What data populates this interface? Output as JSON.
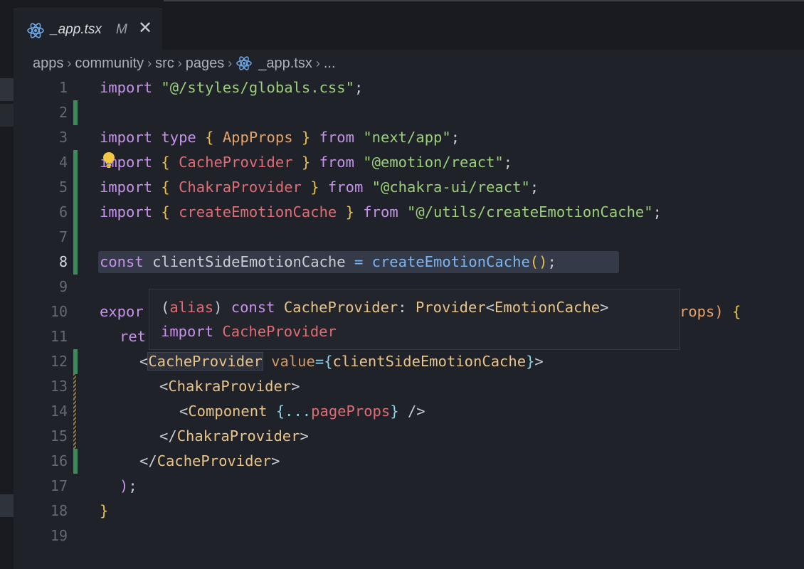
{
  "tab": {
    "filename": "_app.tsx",
    "status": "M"
  },
  "breadcrumb": [
    "apps",
    "community",
    "src",
    "pages",
    "_app.tsx",
    "..."
  ],
  "lines": [
    "1",
    "2",
    "3",
    "4",
    "5",
    "6",
    "7",
    "8",
    "9",
    "10",
    "11",
    "12",
    "13",
    "14",
    "15",
    "16",
    "17",
    "18",
    "19"
  ],
  "active_line": "8",
  "code": {
    "l1": {
      "kw": "import",
      "str": "\"@/styles/globals.css\"",
      "end": ";"
    },
    "l3": {
      "kw1": "import",
      "kw2": "type",
      "ob": "{",
      "id": "AppProps",
      "cb": "}",
      "from": "from",
      "str": "\"next/app\"",
      "end": ";"
    },
    "l4": {
      "kw": "import",
      "ob": "{",
      "id": "CacheProvider",
      "cb": "}",
      "from": "from",
      "str": "\"@emotion/react\"",
      "end": ";"
    },
    "l5": {
      "kw": "import",
      "ob": "{",
      "id": "ChakraProvider",
      "cb": "}",
      "from": "from",
      "str": "\"@chakra-ui/react\"",
      "end": ";"
    },
    "l6": {
      "kw": "import",
      "ob": "{",
      "id": "createEmotionCache",
      "cb": "}",
      "from": "from",
      "str": "\"@/utils/createEmotionCache\"",
      "end": ";"
    },
    "l8": {
      "kw": "const",
      "id": "clientSideEmotionCache",
      "eq": "=",
      "fn": "createEmotionCache",
      "paren": "()",
      "end": ";"
    },
    "l10": {
      "start": "expor",
      "tail": "rops)",
      "brace": "{"
    },
    "l11": {
      "start": "ret"
    },
    "l12": {
      "lt": "<",
      "tag": "CacheProvider",
      "attr": "value",
      "eq": "=",
      "ob": "{",
      "val": "clientSideEmotionCache",
      "cb": "}",
      "gt": ">"
    },
    "l13": {
      "lt": "<",
      "tag": "ChakraProvider",
      "gt": ">"
    },
    "l14": {
      "lt": "<",
      "tag": "Component",
      "ob": "{",
      "spread": "...",
      "val": "pageProps",
      "cb": "}",
      "close": "/>"
    },
    "l15": {
      "lt": "</",
      "tag": "ChakraProvider",
      "gt": ">"
    },
    "l16": {
      "lt": "</",
      "tag": "CacheProvider",
      "gt": ">"
    },
    "l17": {
      "paren": ")",
      "end": ";"
    },
    "l18": {
      "brace": "}"
    }
  },
  "hover": {
    "line1": {
      "op": "(",
      "alias": "alias",
      "cp": ")",
      "kw": "const",
      "name": "CacheProvider",
      "colon": ":",
      "type": "Provider",
      "lt": "<",
      "generic": "EmotionCache",
      "gt": ">"
    },
    "line2": {
      "kw": "import",
      "name": "CacheProvider"
    }
  },
  "icons": {
    "file": "react-icon",
    "close": "close-icon",
    "bulb": "lightbulb-icon"
  },
  "colors": {
    "background": "#1f2228",
    "gutter_added": "#3c8b5a",
    "gutter_modified": "#8a7a4a"
  }
}
